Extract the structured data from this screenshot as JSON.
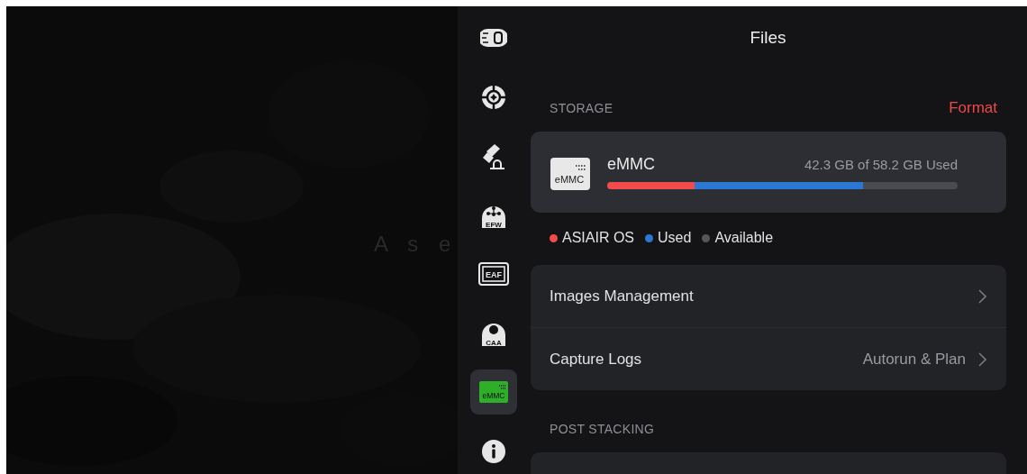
{
  "background_text": "A s e",
  "sidebar": {
    "items": [
      {
        "kind": "camera",
        "selected": false
      },
      {
        "kind": "guide",
        "selected": false
      },
      {
        "kind": "mount",
        "selected": false
      },
      {
        "kind": "efw",
        "label": "EFW",
        "selected": false
      },
      {
        "kind": "eaf",
        "label": "EAF",
        "selected": false
      },
      {
        "kind": "caa",
        "label": "CAA",
        "selected": false
      },
      {
        "kind": "emmc",
        "label": "eMMC",
        "selected": true
      },
      {
        "kind": "info",
        "selected": false
      }
    ]
  },
  "panel": {
    "title": "Files",
    "storage": {
      "heading": "STORAGE",
      "action": "Format",
      "device": {
        "chip_label": "eMMC",
        "name": "eMMC",
        "usage": "42.3 GB of 58.2 GB Used",
        "segments": [
          {
            "level": 0.25,
            "color": "#f24b4b"
          },
          {
            "level": 0.48,
            "color": "#2a78d4"
          }
        ]
      },
      "legend": [
        {
          "label": "ASIAIR OS",
          "color": "#f24b4b"
        },
        {
          "label": "Used",
          "color": "#2a78d4"
        },
        {
          "label": "Available",
          "color": "#55565b"
        }
      ]
    },
    "rows": [
      {
        "label": "Images Management"
      },
      {
        "label": "Capture Logs",
        "value": "Autorun & Plan"
      }
    ],
    "post_stacking": {
      "heading": "POST STACKING"
    }
  }
}
